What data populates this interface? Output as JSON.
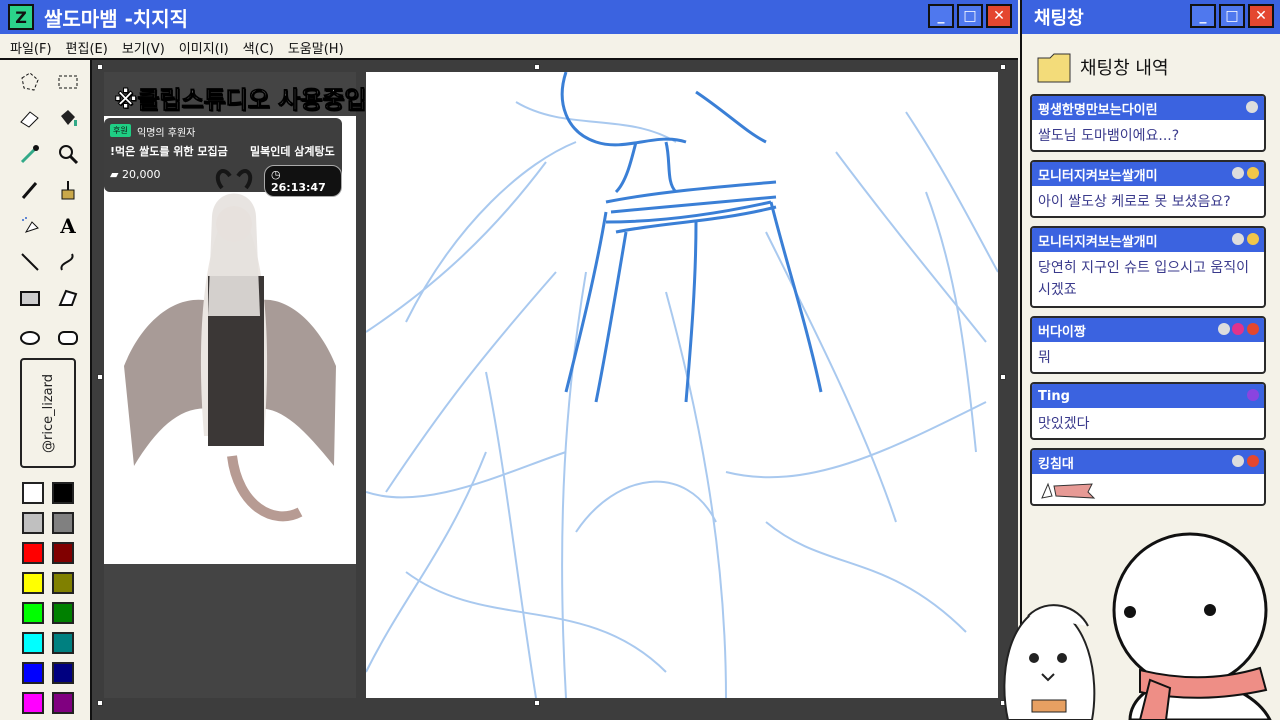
{
  "app": {
    "title": "쌀도마뱀 -치지직",
    "logo_letter": "Z"
  },
  "menu": [
    "파일(F)",
    "편집(E)",
    "보기(V)",
    "이미지(I)",
    "색(C)",
    "도움말(H)"
  ],
  "overlay_notice": "※클립스튜디오 사용중입니다.",
  "donation": {
    "tag": "후원",
    "sponsor": "익명의 후원자",
    "title": "!먹은 쌀도를 위한 모집금",
    "subtitle": "밀복인데 삼계탕도",
    "amount": "20,000",
    "timer": "26:13:47"
  },
  "signature": "@rice_lizard",
  "palette": [
    "#ffffff",
    "#000000",
    "#c0c0c0",
    "#808080",
    "#ff0000",
    "#800000",
    "#ffff00",
    "#808000",
    "#00ff00",
    "#008000",
    "#00ffff",
    "#008080",
    "#0000ff",
    "#000080",
    "#ff00ff",
    "#800080"
  ],
  "chat": {
    "title": "채팅창",
    "history_label": "채팅창 내역",
    "messages": [
      {
        "user": "평생한명만보는다이린",
        "text": "쌀도님 도마뱀이에요...?"
      },
      {
        "user": "모니터지켜보는쌀개미",
        "text": "아이 쌀도상 케로로 못 보셨음요?"
      },
      {
        "user": "모니터지켜보는쌀개미",
        "text": "당연히 지구인 슈트 입으시고 움직이시겠죠"
      },
      {
        "user": "버다이짱",
        "text": "뭐"
      },
      {
        "user": "Ting",
        "text": "맛있겠다"
      },
      {
        "user": "킹침대",
        "text": ""
      }
    ]
  },
  "colors": {
    "accent": "#3b63e0",
    "close": "#e4472f",
    "sketch_dark": "#3a7fd6",
    "sketch_light": "#a9c9ef"
  }
}
